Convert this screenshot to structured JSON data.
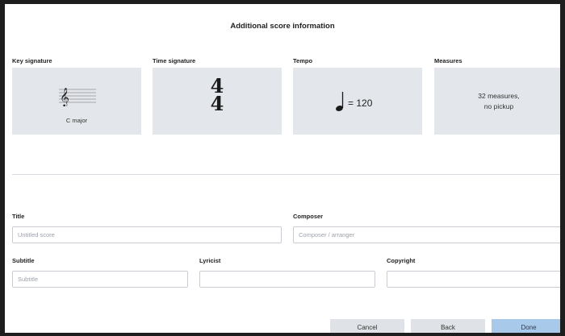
{
  "dialog": {
    "title": "Additional score information"
  },
  "sections": {
    "key_signature": {
      "label": "Key signature",
      "value": "C major",
      "icon": "treble-clef-staff-icon"
    },
    "time_signature": {
      "label": "Time signature",
      "numerator": "4",
      "denominator": "4"
    },
    "tempo": {
      "label": "Tempo",
      "note_icon": "quarter-note-icon",
      "value": "= 120"
    },
    "measures": {
      "label": "Measures",
      "line1": "32 measures,",
      "line2": "no pickup"
    }
  },
  "fields": {
    "title": {
      "label": "Title",
      "value": "",
      "placeholder": "Untitled score"
    },
    "composer": {
      "label": "Composer",
      "value": "",
      "placeholder": "Composer / arranger"
    },
    "subtitle": {
      "label": "Subtitle",
      "value": "",
      "placeholder": "Subtitle"
    },
    "lyricist": {
      "label": "Lyricist",
      "value": "",
      "placeholder": ""
    },
    "copyright": {
      "label": "Copyright",
      "value": "",
      "placeholder": ""
    }
  },
  "buttons": {
    "cancel": "Cancel",
    "back": "Back",
    "done": "Done"
  },
  "colors": {
    "card_bg": "#e3e6ea",
    "primary_button": "#a9c9ea",
    "secondary_button": "#dfe2e6"
  }
}
